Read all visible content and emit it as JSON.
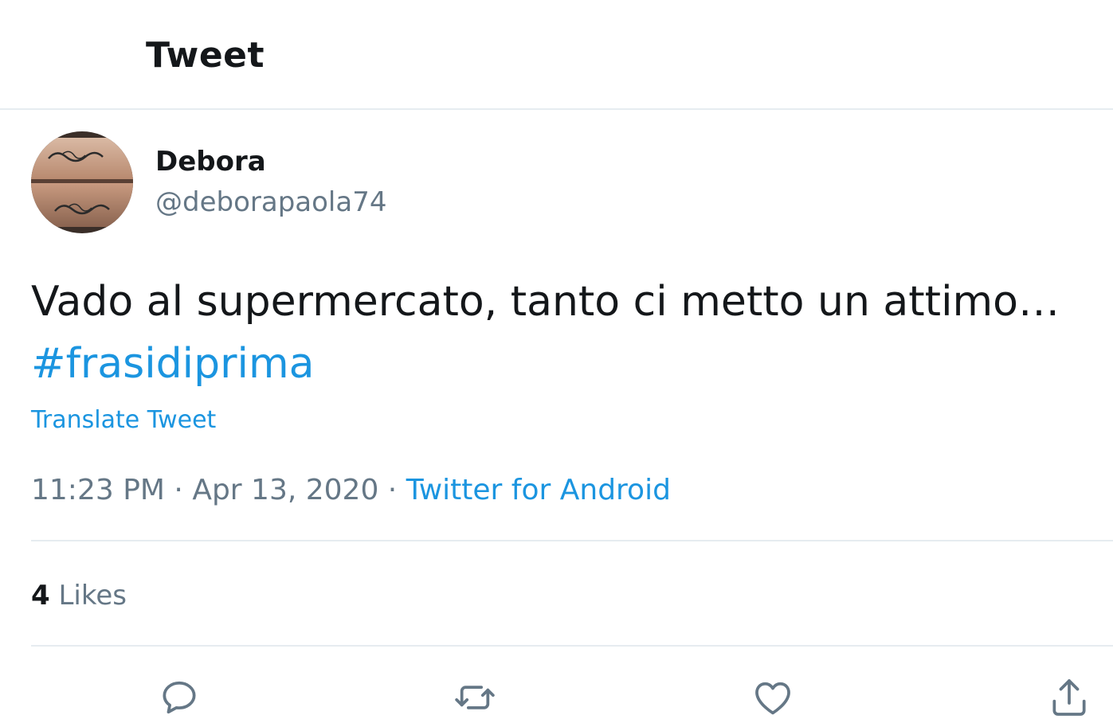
{
  "header": {
    "title": "Tweet"
  },
  "author": {
    "display_name": "Debora",
    "handle": "@deborapaola74"
  },
  "tweet": {
    "text": "Vado al supermercato, tanto ci metto un attimo…",
    "hashtag": "#frasidiprima",
    "translate_label": "Translate Tweet"
  },
  "meta": {
    "time": "11:23 PM",
    "separator": " · ",
    "date": "Apr 13, 2020",
    "source": "Twitter for Android"
  },
  "stats": {
    "likes_count": "4",
    "likes_label": "Likes"
  },
  "actions": {
    "reply": "reply-icon",
    "retweet": "retweet-icon",
    "like": "heart-icon",
    "share": "share-icon"
  },
  "colors": {
    "link": "#1b95e0",
    "secondary_text": "#657786",
    "primary_text": "#14171a",
    "divider": "#e6ecf0"
  }
}
